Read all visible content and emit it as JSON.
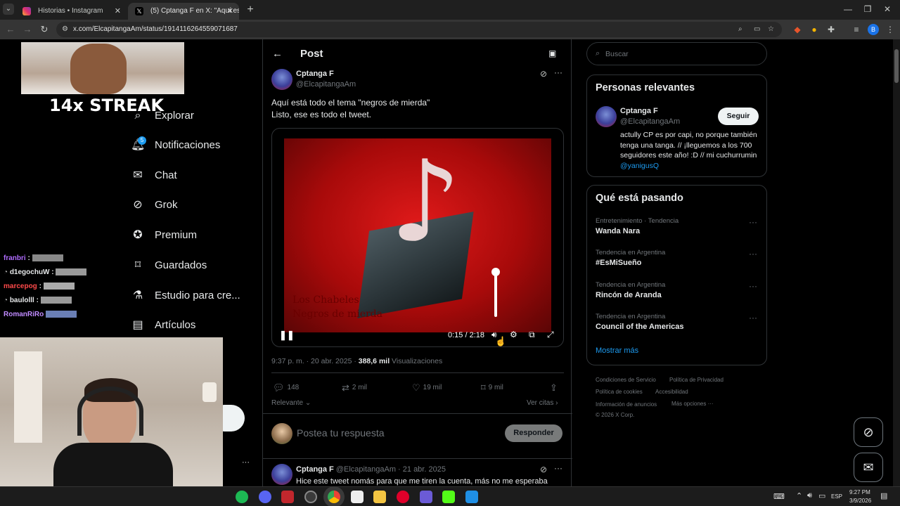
{
  "browser": {
    "tabs": [
      {
        "title": "Historias • Instagram"
      },
      {
        "title": "(5) Cptanga F en X: \"Aquí está...\""
      }
    ],
    "url": "x.com/ElcapitangaAm/status/1914116264559071687"
  },
  "stream_overlay": {
    "streak": "14x STREAK",
    "chat": [
      {
        "user": "franbri",
        "color": "#b06cff"
      },
      {
        "user": "d1egochuW",
        "color": "#e7e9ea"
      },
      {
        "user": "marcepog",
        "color": "#ff4a4a"
      },
      {
        "user": "baulolll",
        "color": "#e7e9ea"
      },
      {
        "user": "RomanRiRo",
        "color": "#c08bff"
      }
    ]
  },
  "sidebar": {
    "items": [
      {
        "label": "Explorar"
      },
      {
        "label": "Notificaciones",
        "badge": "5"
      },
      {
        "label": "Chat"
      },
      {
        "label": "Grok"
      },
      {
        "label": "Premium"
      },
      {
        "label": "Guardados"
      },
      {
        "label": "Estudio para cre..."
      },
      {
        "label": "Artículos"
      }
    ],
    "more": "···"
  },
  "post": {
    "header_title": "Post",
    "author_name": "Cptanga F",
    "author_handle": "@ElcapitangaAm",
    "text_line1": "Aquí está todo el tema \"negros de mierda\"",
    "text_line2": "Listo, ese es todo el tweet.",
    "video": {
      "time": "0:15 / 2:18",
      "overlay_line1": "Los Chabeles",
      "overlay_line2": "Negros de mierda"
    },
    "timestamp": "9:37 p. m. · 20 abr. 2025 · ",
    "views_count": "388,6 mil",
    "views_label": "Visualizaciones",
    "replies": "148",
    "reposts": "2 mil",
    "likes": "19 mil",
    "bookmarks": "9 mil",
    "sort_label": "Relevante",
    "quotes_label": "Ver citas",
    "reply_placeholder": "Postea tu respuesta",
    "reply_button": "Responder"
  },
  "next_post": {
    "author_name": "Cptanga F",
    "meta": "@ElcapitangaAm · 21 abr. 2025",
    "text": "Hice este tweet nomás para que me tiren la cuenta, más no me esperaba"
  },
  "right": {
    "search_placeholder": "Buscar",
    "people_title": "Personas relevantes",
    "person": {
      "name": "Cptanga F",
      "handle": "@ElcapitangaAm",
      "follow": "Seguir",
      "bio": "actully CP es por capi, no porque también tenga una tanga. // ¡lleguemos a los 700 seguidores este año! :D // mi cuchurrumin",
      "mention": "@yanigusQ"
    },
    "trends_title": "Qué está pasando",
    "trends": [
      {
        "context": "Entretenimiento · Tendencia",
        "name": "Wanda Nara"
      },
      {
        "context": "Tendencia en Argentina",
        "name": "#EsMiSueño"
      },
      {
        "context": "Tendencia en Argentina",
        "name": "Rincón de Aranda"
      },
      {
        "context": "Tendencia en Argentina",
        "name": "Council of the Americas"
      }
    ],
    "show_more": "Mostrar más",
    "footer": {
      "terms": "Condiciones de Servicio",
      "privacy": "Política de Privacidad",
      "cookies": "Política de cookies",
      "accessibility": "Accesibilidad",
      "ads": "Información de anuncios",
      "more": "Más opciones ···",
      "copyright": "© 2026 X Corp."
    }
  },
  "taskbar": {
    "lang": "ESP",
    "time": "9:27 PM",
    "date": "3/9/2026"
  },
  "colors": {
    "accent": "#1d9bf0",
    "background": "#000000",
    "border": "#2f3336"
  }
}
